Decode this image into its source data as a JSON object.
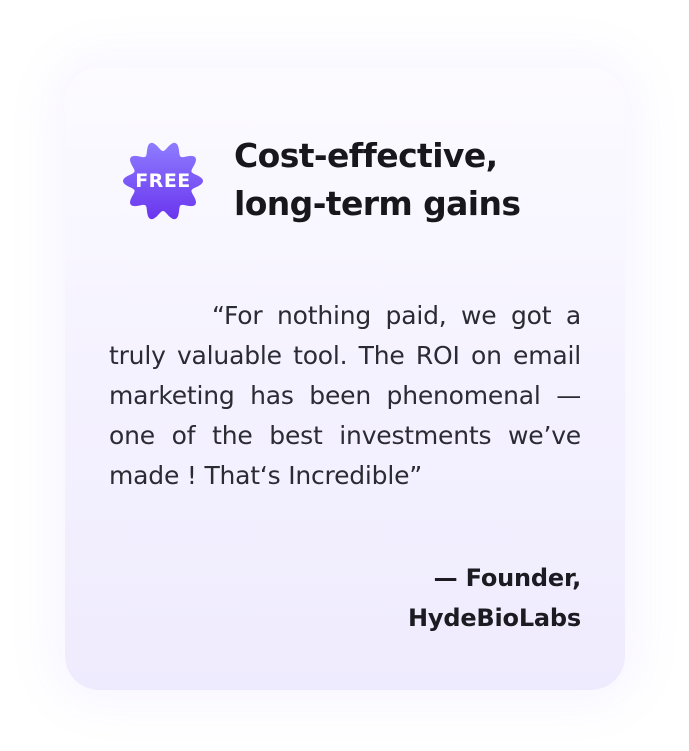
{
  "badge": {
    "label": "FREE",
    "icon": "free-badge-icon",
    "colors": {
      "top": "#8e7cff",
      "bottom": "#6a35ee"
    }
  },
  "heading": {
    "line1": "Cost-effective,",
    "line2": "long-term gains"
  },
  "testimonial": {
    "quote": "“For nothing paid, we got a truly valuable tool. The ROI on email marketing has been phenomenal — one of the best investments we’ve made ! That‘s Incredible”",
    "author": "— Founder,",
    "company": "HydeBioLabs"
  },
  "colors": {
    "card_background": "#f4f1ff",
    "heading_text": "#17171c",
    "body_text": "#2b2b33"
  }
}
